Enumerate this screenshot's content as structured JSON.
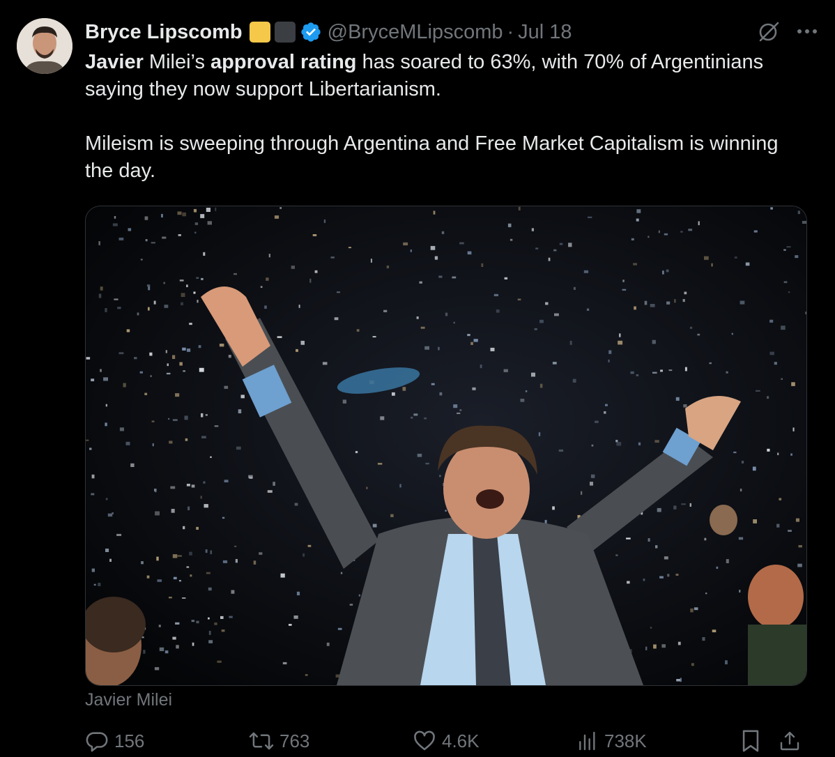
{
  "author": {
    "name": "Bryce Lipscomb",
    "handle": "@BryceMLipscomb",
    "separator": "·",
    "date": "Jul 18"
  },
  "tweet": {
    "paragraph1": {
      "part1_bold": "Javier",
      "part2": " Milei’s ",
      "part3_bold": "approval rating",
      "part4": " has soared to 63%, with 70% of Argentinians saying they now support Libertarianism."
    },
    "paragraph2": "Mileism is sweeping through Argentina and Free Market Capitalism is winning the day."
  },
  "media": {
    "caption": "Javier Milei"
  },
  "actions": {
    "replies": "156",
    "reposts": "763",
    "likes": "4.6K",
    "views": "738K"
  },
  "icons": [
    "grok-icon",
    "more-icon",
    "verified-icon",
    "reply-icon",
    "repost-icon",
    "like-icon",
    "views-icon",
    "bookmark-icon",
    "share-icon"
  ],
  "colors": {
    "background": "#000000",
    "text": "#e7e9ea",
    "muted": "#71767b",
    "verified": "#1d9bf0",
    "badge_yellow": "#f5c84a"
  }
}
